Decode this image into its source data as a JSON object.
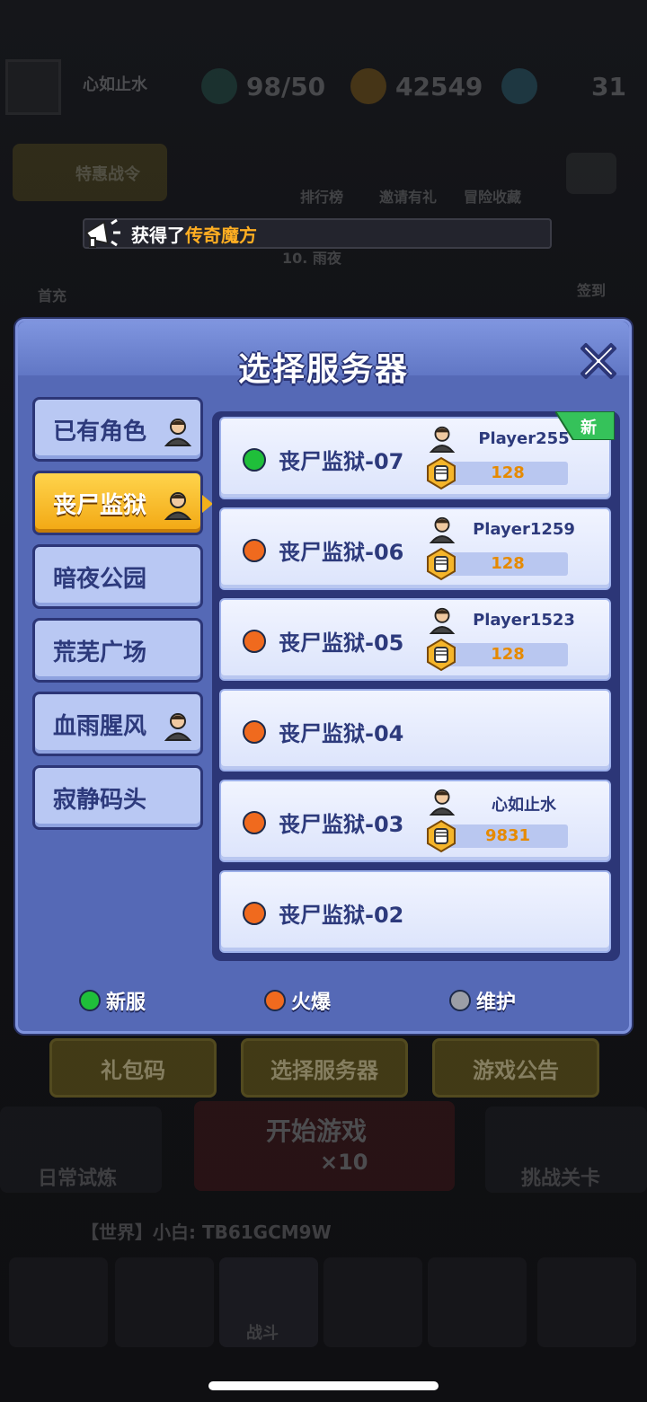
{
  "background": {
    "player_name": "心如止水",
    "energy": "98/50",
    "coins": "42549",
    "gems": "31",
    "top_buttons": [
      "特惠战令",
      "排行榜",
      "邀请有礼",
      "冒险收藏"
    ],
    "side_left": "首充",
    "side_right": "签到",
    "level_text": "10. 雨夜",
    "bottom_buttons": [
      "礼包码",
      "选择服务器",
      "游戏公告"
    ],
    "start_game": "开始游戏",
    "start_cost": "×10",
    "daily_trial": "日常试炼",
    "challenge": "挑战关卡",
    "world_chat": "【世界】小白: TB61GCM9W",
    "nav_center": "战斗"
  },
  "toast": {
    "prefix": "获得了",
    "item": "传奇魔方"
  },
  "modal": {
    "title": "选择服务器",
    "tabs": [
      {
        "label": "已有角色",
        "has_role": true,
        "active": false
      },
      {
        "label": "丧尸监狱",
        "has_role": true,
        "active": true
      },
      {
        "label": "暗夜公园",
        "has_role": false,
        "active": false
      },
      {
        "label": "荒芜广场",
        "has_role": false,
        "active": false
      },
      {
        "label": "血雨腥风",
        "has_role": true,
        "active": false
      },
      {
        "label": "寂静码头",
        "has_role": false,
        "active": false
      }
    ],
    "servers": [
      {
        "name": "丧尸监狱-07",
        "status": "new",
        "player": "Player255",
        "power": "128",
        "is_new": true,
        "new_tag": "新"
      },
      {
        "name": "丧尸监狱-06",
        "status": "hot",
        "player": "Player1259",
        "power": "128"
      },
      {
        "name": "丧尸监狱-05",
        "status": "hot",
        "player": "Player1523",
        "power": "128"
      },
      {
        "name": "丧尸监狱-04",
        "status": "hot"
      },
      {
        "name": "丧尸监狱-03",
        "status": "hot",
        "player": "心如止水",
        "power": "9831"
      },
      {
        "name": "丧尸监狱-02",
        "status": "hot"
      }
    ],
    "legend": {
      "new": "新服",
      "hot": "火爆",
      "maintenance": "维护"
    }
  },
  "colors": {
    "status_new": "#1fbf3a",
    "status_hot": "#f06a1e",
    "status_maintenance": "#9b9ea6",
    "highlight": "#ffae22"
  }
}
